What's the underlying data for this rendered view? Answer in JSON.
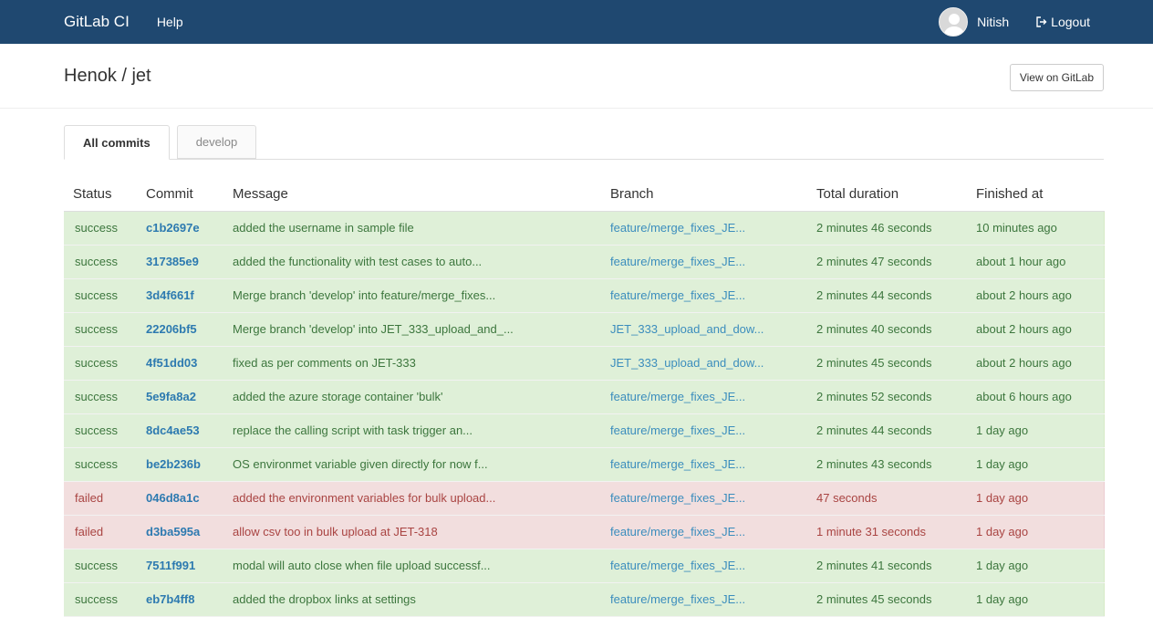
{
  "navbar": {
    "brand": "GitLab CI",
    "help": "Help",
    "username": "Nitish",
    "logout": "Logout",
    "bg_color": "#1f4870"
  },
  "header": {
    "title": "Henok / jet",
    "view_button": "View on GitLab"
  },
  "tabs": [
    {
      "label": "All commits",
      "active": true
    },
    {
      "label": "develop",
      "active": false
    }
  ],
  "table": {
    "columns": [
      "Status",
      "Commit",
      "Message",
      "Branch",
      "Total duration",
      "Finished at"
    ],
    "rows": [
      {
        "status": "success",
        "commit": "c1b2697e",
        "message": "added the username in sample file",
        "branch": "feature/merge_fixes_JE...",
        "duration": "2 minutes 46 seconds",
        "finished": "10 minutes ago"
      },
      {
        "status": "success",
        "commit": "317385e9",
        "message": "added the functionality with test cases to auto...",
        "branch": "feature/merge_fixes_JE...",
        "duration": "2 minutes 47 seconds",
        "finished": "about 1 hour ago"
      },
      {
        "status": "success",
        "commit": "3d4f661f",
        "message": "Merge branch 'develop' into feature/merge_fixes...",
        "branch": "feature/merge_fixes_JE...",
        "duration": "2 minutes 44 seconds",
        "finished": "about 2 hours ago"
      },
      {
        "status": "success",
        "commit": "22206bf5",
        "message": "Merge branch 'develop' into JET_333_upload_and_...",
        "branch": "JET_333_upload_and_dow...",
        "duration": "2 minutes 40 seconds",
        "finished": "about 2 hours ago"
      },
      {
        "status": "success",
        "commit": "4f51dd03",
        "message": "fixed as per comments on JET-333",
        "branch": "JET_333_upload_and_dow...",
        "duration": "2 minutes 45 seconds",
        "finished": "about 2 hours ago"
      },
      {
        "status": "success",
        "commit": "5e9fa8a2",
        "message": "added the azure storage container 'bulk'",
        "branch": "feature/merge_fixes_JE...",
        "duration": "2 minutes 52 seconds",
        "finished": "about 6 hours ago"
      },
      {
        "status": "success",
        "commit": "8dc4ae53",
        "message": "replace the calling script with task trigger an...",
        "branch": "feature/merge_fixes_JE...",
        "duration": "2 minutes 44 seconds",
        "finished": "1 day ago"
      },
      {
        "status": "success",
        "commit": "be2b236b",
        "message": "OS environmet variable given directly for now f...",
        "branch": "feature/merge_fixes_JE...",
        "duration": "2 minutes 43 seconds",
        "finished": "1 day ago"
      },
      {
        "status": "failed",
        "commit": "046d8a1c",
        "message": "added the environment variables for bulk upload...",
        "branch": "feature/merge_fixes_JE...",
        "duration": "47 seconds",
        "finished": "1 day ago"
      },
      {
        "status": "failed",
        "commit": "d3ba595a",
        "message": "allow csv too in bulk upload at JET-318",
        "branch": "feature/merge_fixes_JE...",
        "duration": "1 minute 31 seconds",
        "finished": "1 day ago"
      },
      {
        "status": "success",
        "commit": "7511f991",
        "message": "modal will auto close when file upload successf...",
        "branch": "feature/merge_fixes_JE...",
        "duration": "2 minutes 41 seconds",
        "finished": "1 day ago"
      },
      {
        "status": "success",
        "commit": "eb7b4ff8",
        "message": "added the dropbox links at settings",
        "branch": "feature/merge_fixes_JE...",
        "duration": "2 minutes 45 seconds",
        "finished": "1 day ago"
      }
    ]
  },
  "colors": {
    "success_bg": "#dff0d8",
    "success_text": "#3c763d",
    "failed_bg": "#f2dede",
    "failed_text": "#a94442",
    "commit_link": "#2d7ab0"
  }
}
